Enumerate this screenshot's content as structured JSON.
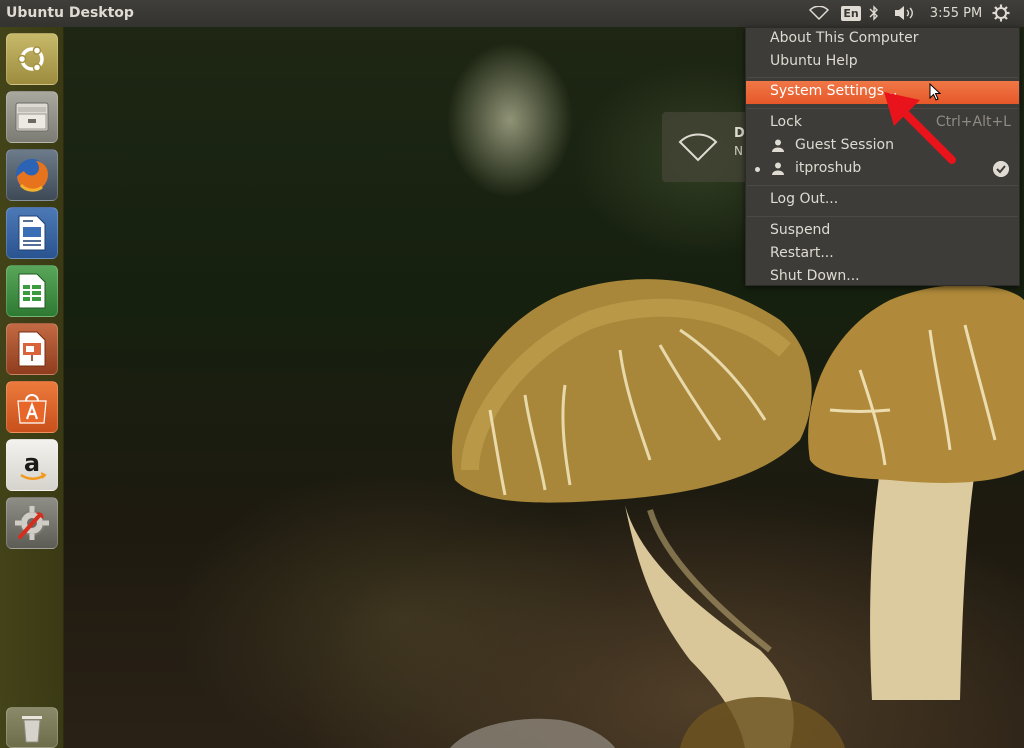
{
  "top_panel": {
    "title": "Ubuntu Desktop",
    "language_indicator": "En",
    "clock": "3:55 PM",
    "icons": [
      "wifi-icon",
      "bluetooth-icon",
      "volume-icon",
      "gear-icon"
    ]
  },
  "launcher": {
    "items": [
      {
        "name": "ubuntu-dash"
      },
      {
        "name": "files"
      },
      {
        "name": "firefox"
      },
      {
        "name": "libreoffice-writer"
      },
      {
        "name": "libreoffice-calc"
      },
      {
        "name": "libreoffice-impress"
      },
      {
        "name": "ubuntu-software-center"
      },
      {
        "name": "amazon"
      },
      {
        "name": "system-settings"
      },
      {
        "name": "trash"
      }
    ]
  },
  "notification": {
    "title": "D",
    "subtitle": "N"
  },
  "session_menu": {
    "about": "About This Computer",
    "help": "Ubuntu Help",
    "settings": "System Settings...",
    "lock": "Lock",
    "lock_accel": "Ctrl+Alt+L",
    "guest": "Guest Session",
    "user": "itproshub",
    "logout": "Log Out...",
    "suspend": "Suspend",
    "restart": "Restart...",
    "shutdown": "Shut Down..."
  },
  "colors": {
    "accent": "#e95420",
    "panel": "#3c3b37",
    "annotation_arrow": "#e8131b"
  }
}
